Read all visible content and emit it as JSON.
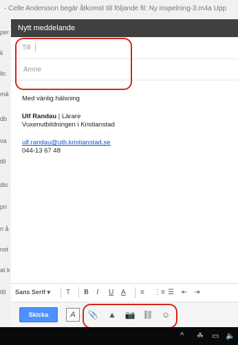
{
  "background": {
    "top_notification": "- Celle Andersson begär åtkomst till följande fil: Ny inspelning-3.m4a Upp",
    "left_fragments": [
      "per",
      "k",
      "lic",
      "mä",
      "db",
      "va",
      "till",
      "dis",
      "pri",
      "n å",
      "nst",
      "at k",
      "till"
    ]
  },
  "compose": {
    "title": "Nytt meddelande",
    "to_label": "Till",
    "subject_placeholder": "Ämne",
    "greeting": "Med vänlig hälsning",
    "signature_name": "Ulf Randau",
    "signature_sep": " | ",
    "signature_role": "Lärare",
    "signature_org": "Vuxenutbildningen i Kristianstad",
    "signature_email": "ulf.randau@utb.kristianstad.se",
    "signature_phone": "044-13 67 48"
  },
  "format_bar": {
    "font": "Sans Serif",
    "font_caret": "▾",
    "size": "T",
    "bold": "B",
    "italic": "I",
    "underline": "U",
    "text_color": "A",
    "align": "≡",
    "numbered_list": "⋮≡",
    "bullet_list": "☰",
    "indent_less": "⇤",
    "indent_more": "⇥"
  },
  "send_row": {
    "send_label": "Skicka",
    "format_icon": "A",
    "attach_icon": "📎",
    "drive_icon": "▲",
    "photo_icon": "📷",
    "link_icon": "⛓",
    "emoji_icon": "☺"
  },
  "taskbar": {
    "chevron": "^",
    "net_icon": "☘",
    "battery_icon": "▭",
    "volume_icon": "🔈"
  },
  "colors": {
    "header": "#404040",
    "send": "#4d90fe",
    "highlight": "#d9201a"
  }
}
